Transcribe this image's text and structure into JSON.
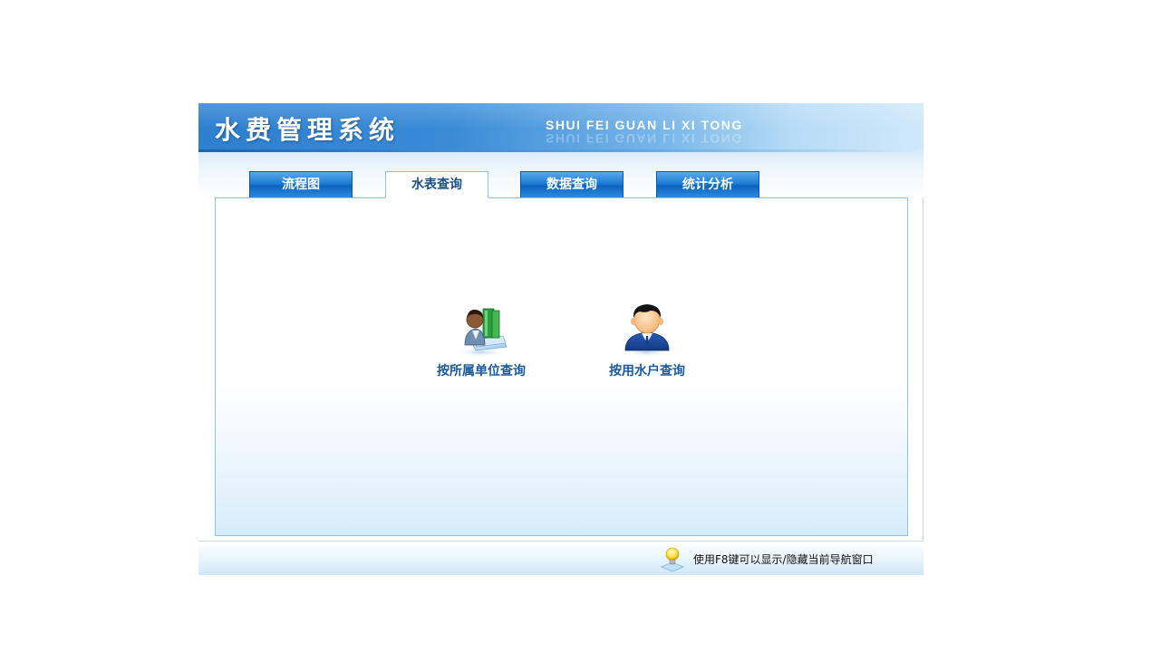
{
  "header": {
    "title": "水费管理系统",
    "subtitle": "SHUI FEI GUAN LI XI TONG"
  },
  "tabs": [
    {
      "label": "流程图",
      "active": false
    },
    {
      "label": "水表查询",
      "active": true
    },
    {
      "label": "数据查询",
      "active": false
    },
    {
      "label": "统计分析",
      "active": false
    }
  ],
  "main": {
    "items": [
      {
        "label": "按所属单位查询",
        "icon": "user-with-books-icon"
      },
      {
        "label": "按用水户查询",
        "icon": "user-icon"
      }
    ]
  },
  "footer": {
    "hint": "使用F8键可以显示/隐藏当前导航窗口",
    "hint_icon": "lightbulb-icon"
  },
  "colors": {
    "header_blue": "#2f7fd0",
    "tab_blue": "#1f7dd6",
    "label_blue": "#1a5a9a",
    "panel_border": "#8ec3ec"
  }
}
